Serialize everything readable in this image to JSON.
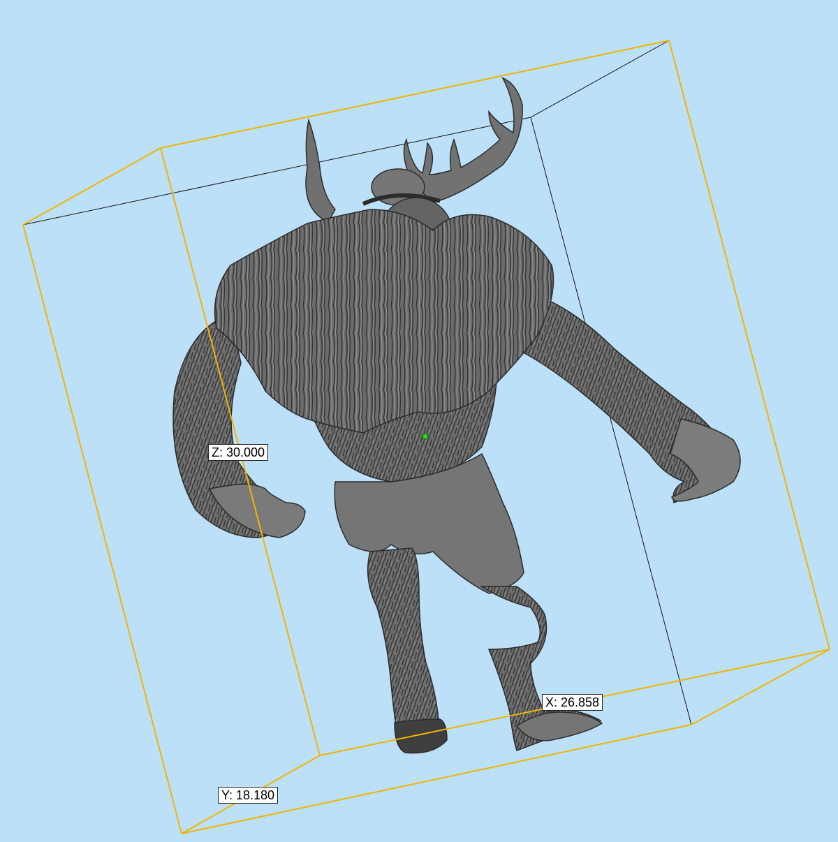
{
  "viewport": {
    "background": "#bde0f9",
    "model_color": "#6a6a6a",
    "bounding_box_color": "#f0b400",
    "center_marker_color": "#22dd22"
  },
  "dimensions": {
    "x_label": "X: 26.858",
    "y_label": "Y: 18.180",
    "z_label": "Z: 30.000"
  }
}
